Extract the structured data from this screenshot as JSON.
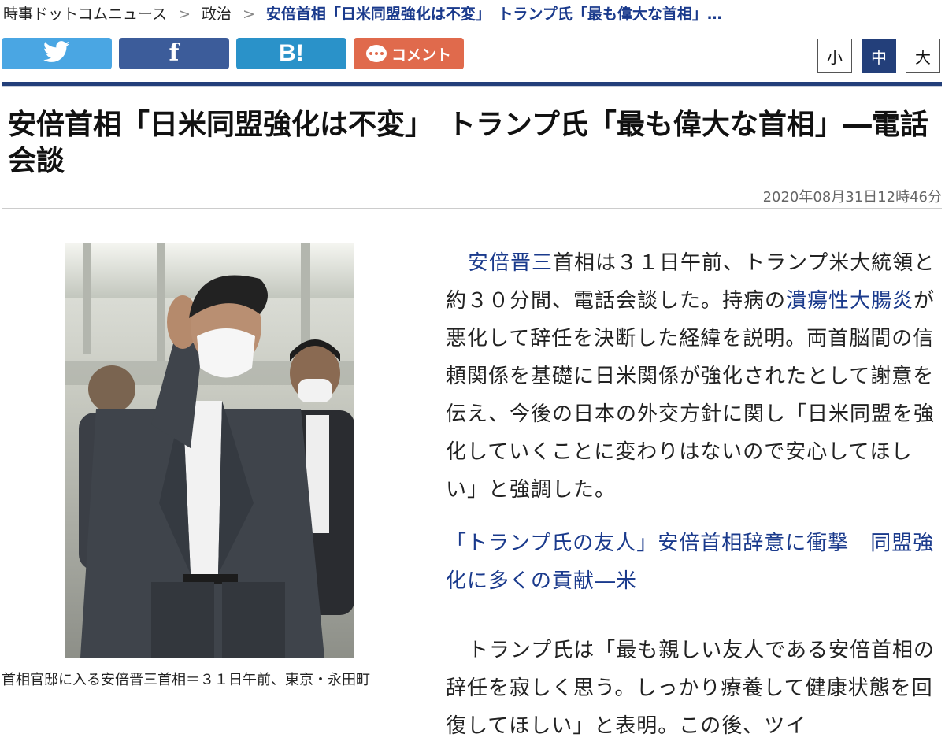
{
  "breadcrumb": {
    "site": "時事ドットコムニュース",
    "category": "政治",
    "current": "安倍首相「日米同盟強化は不変」　トランプ氏「最も偉大な首相」…",
    "separator": ">"
  },
  "share": {
    "twitter_icon": "twitter-bird-icon",
    "facebook_glyph": "f",
    "hatena_glyph": "B!",
    "comment_label": "コメント"
  },
  "font_size": {
    "small": "小",
    "medium": "中",
    "large": "大",
    "selected": "中"
  },
  "article": {
    "headline": "安倍首相「日米同盟強化は不変」　トランプ氏「最も偉大な首相」―電話会談",
    "timestamp": "2020年08月31日12時46分",
    "caption": "首相官邸に入る安倍晋三首相＝３１日午前、東京・永田町",
    "p1": {
      "link1": "安倍晋三",
      "text1": "首相は３１日午前、トランプ米大統領と約３０分間、電話会談した。持病の",
      "link2": "潰瘍性大腸炎",
      "text2": "が悪化して辞任を決断した経緯を説明。両首脳間の信頼関係を基礎に日米関係が強化されたとして謝意を伝え、今後の日本の外交方針に関し「日米同盟を強化していくことに変わりはないので安心してほしい」と強調した。"
    },
    "related_link": "「トランプ氏の友人」安倍首相辞意に衝撃　同盟強化に多くの貢献―米",
    "p2": "トランプ氏は「最も親しい友人である安倍首相の辞任を寂しく思う。しっかり療養して健康状態を回復してほしい」と表明。この後、ツイ"
  },
  "colors": {
    "navy": "#233f7a",
    "link": "#1a3a8c",
    "twitter": "#4aa6e3",
    "facebook": "#3c5c9a",
    "hatena": "#2a92c9",
    "comment": "#e06a4c"
  }
}
